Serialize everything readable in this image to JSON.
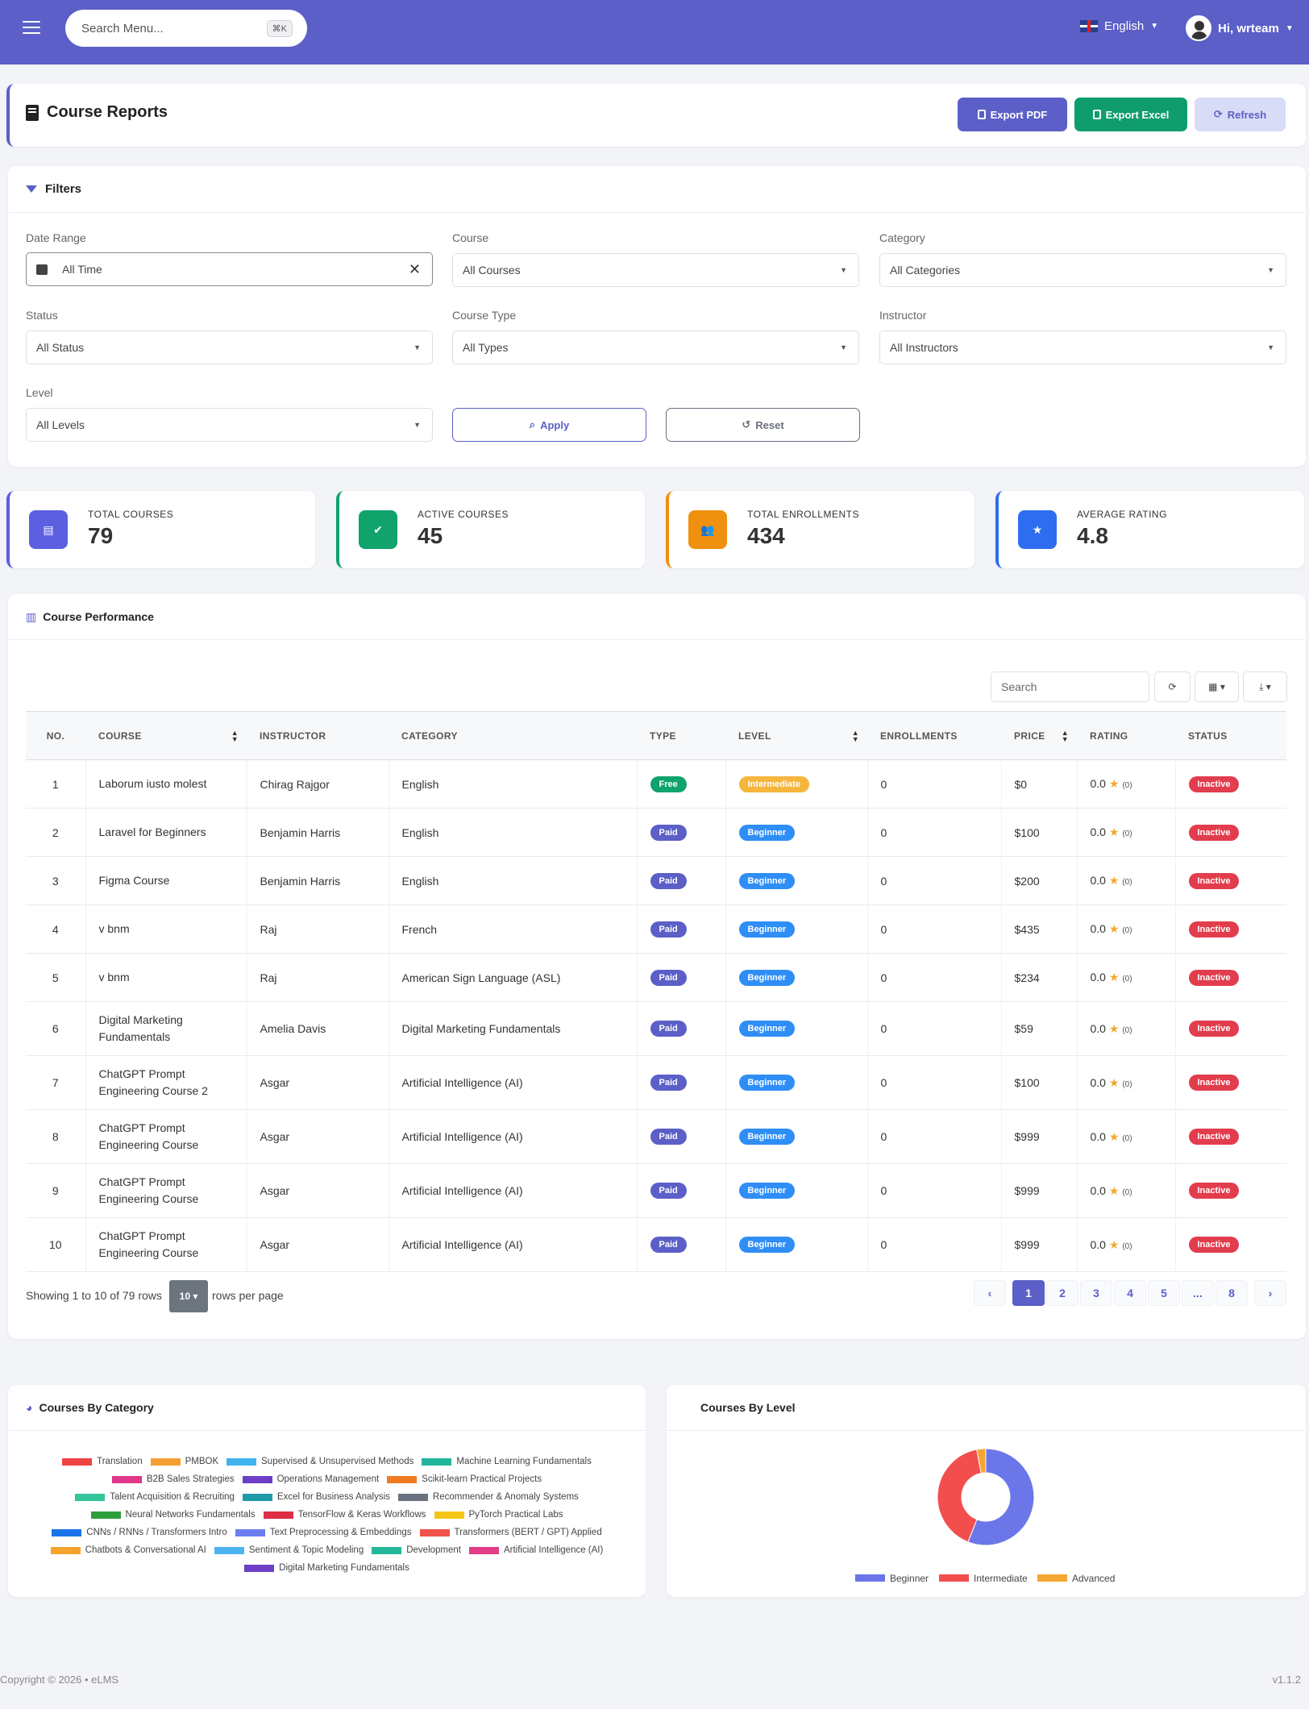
{
  "topbar": {
    "search_placeholder": "Search Menu...",
    "search_shortcut": "⌘K",
    "language": "English",
    "greeting": "Hi, wrteam"
  },
  "header": {
    "title": "Course Reports",
    "export_pdf": "Export PDF",
    "export_excel": "Export Excel",
    "refresh": "Refresh"
  },
  "filters": {
    "title": "Filters",
    "date_range": {
      "label": "Date Range",
      "value": "All Time"
    },
    "course": {
      "label": "Course",
      "value": "All Courses"
    },
    "category": {
      "label": "Category",
      "value": "All Categories"
    },
    "status": {
      "label": "Status",
      "value": "All Status"
    },
    "course_type": {
      "label": "Course Type",
      "value": "All Types"
    },
    "instructor": {
      "label": "Instructor",
      "value": "All Instructors"
    },
    "level": {
      "label": "Level",
      "value": "All Levels"
    },
    "apply": "Apply",
    "reset": "Reset"
  },
  "stats": [
    {
      "label": "TOTAL COURSES",
      "value": "79",
      "color": "#5b5fe0"
    },
    {
      "label": "ACTIVE COURSES",
      "value": "45",
      "color": "#10a36c"
    },
    {
      "label": "TOTAL ENROLLMENTS",
      "value": "434",
      "color": "#f0900f"
    },
    {
      "label": "AVERAGE RATING",
      "value": "4.8",
      "color": "#2f6df0"
    }
  ],
  "performance": {
    "title": "Course Performance",
    "search_placeholder": "Search",
    "columns": [
      "NO.",
      "COURSE",
      "INSTRUCTOR",
      "CATEGORY",
      "TYPE",
      "LEVEL",
      "ENROLLMENTS",
      "PRICE",
      "RATING",
      "STATUS"
    ],
    "rows": [
      {
        "no": "1",
        "course": "Laborum iusto molest",
        "instructor": "Chirag Rajgor",
        "category": "English",
        "type": "Free",
        "level": "Intermediate",
        "enrollments": "0",
        "price": "$0",
        "rating": "0.0",
        "rating_count": "(0)",
        "status": "Inactive"
      },
      {
        "no": "2",
        "course": "Laravel for Beginners",
        "instructor": "Benjamin Harris",
        "category": "English",
        "type": "Paid",
        "level": "Beginner",
        "enrollments": "0",
        "price": "$100",
        "rating": "0.0",
        "rating_count": "(0)",
        "status": "Inactive"
      },
      {
        "no": "3",
        "course": "Figma Course",
        "instructor": "Benjamin Harris",
        "category": "English",
        "type": "Paid",
        "level": "Beginner",
        "enrollments": "0",
        "price": "$200",
        "rating": "0.0",
        "rating_count": "(0)",
        "status": "Inactive"
      },
      {
        "no": "4",
        "course": "v bnm",
        "instructor": "Raj",
        "category": "French",
        "type": "Paid",
        "level": "Beginner",
        "enrollments": "0",
        "price": "$435",
        "rating": "0.0",
        "rating_count": "(0)",
        "status": "Inactive"
      },
      {
        "no": "5",
        "course": "v bnm",
        "instructor": "Raj",
        "category": "American Sign Language (ASL)",
        "type": "Paid",
        "level": "Beginner",
        "enrollments": "0",
        "price": "$234",
        "rating": "0.0",
        "rating_count": "(0)",
        "status": "Inactive"
      },
      {
        "no": "6",
        "course": "Digital Marketing Fundamentals",
        "instructor": "Amelia Davis",
        "category": "Digital Marketing Fundamentals",
        "type": "Paid",
        "level": "Beginner",
        "enrollments": "0",
        "price": "$59",
        "rating": "0.0",
        "rating_count": "(0)",
        "status": "Inactive"
      },
      {
        "no": "7",
        "course": "ChatGPT Prompt Engineering Course 2",
        "instructor": "Asgar",
        "category": "Artificial Intelligence (AI)",
        "type": "Paid",
        "level": "Beginner",
        "enrollments": "0",
        "price": "$100",
        "rating": "0.0",
        "rating_count": "(0)",
        "status": "Inactive"
      },
      {
        "no": "8",
        "course": "ChatGPT Prompt Engineering Course",
        "instructor": "Asgar",
        "category": "Artificial Intelligence (AI)",
        "type": "Paid",
        "level": "Beginner",
        "enrollments": "0",
        "price": "$999",
        "rating": "0.0",
        "rating_count": "(0)",
        "status": "Inactive"
      },
      {
        "no": "9",
        "course": "ChatGPT Prompt Engineering Course",
        "instructor": "Asgar",
        "category": "Artificial Intelligence (AI)",
        "type": "Paid",
        "level": "Beginner",
        "enrollments": "0",
        "price": "$999",
        "rating": "0.0",
        "rating_count": "(0)",
        "status": "Inactive"
      },
      {
        "no": "10",
        "course": "ChatGPT Prompt Engineering Course",
        "instructor": "Asgar",
        "category": "Artificial Intelligence (AI)",
        "type": "Paid",
        "level": "Beginner",
        "enrollments": "0",
        "price": "$999",
        "rating": "0.0",
        "rating_count": "(0)",
        "status": "Inactive"
      }
    ],
    "showing": "Showing 1 to 10 of 79 rows",
    "per_page_value": "10 ▾",
    "per_page_label": "rows per page",
    "pages": [
      "‹",
      "1",
      "2",
      "3",
      "4",
      "5",
      "...",
      "8",
      "›"
    ],
    "active_page": "1"
  },
  "category_chart": {
    "title": "Courses By Category",
    "legend": [
      {
        "name": "Translation",
        "color": "#ef4444"
      },
      {
        "name": "PMBOK",
        "color": "#f59e33"
      },
      {
        "name": "Supervised & Unsupervised Methods",
        "color": "#3fb3ee"
      },
      {
        "name": "Machine Learning Fundamentals",
        "color": "#23b59b"
      },
      {
        "name": "B2B Sales Strategies",
        "color": "#e0378a"
      },
      {
        "name": "Operations Management",
        "color": "#6d3fc4"
      },
      {
        "name": "Scikit-learn Practical Projects",
        "color": "#f07b22"
      },
      {
        "name": "Talent Acquisition & Recruiting",
        "color": "#33c49a"
      },
      {
        "name": "Excel for Business Analysis",
        "color": "#1f9aa8"
      },
      {
        "name": "Recommender & Anomaly Systems",
        "color": "#6b7280"
      },
      {
        "name": "Neural Networks Fundamentals",
        "color": "#2e9e3d"
      },
      {
        "name": "TensorFlow & Keras Workflows",
        "color": "#dc2f45"
      },
      {
        "name": "PyTorch Practical Labs",
        "color": "#f5c518"
      },
      {
        "name": "CNNs / RNNs / Transformers Intro",
        "color": "#1a73e8"
      },
      {
        "name": "Text Preprocessing & Embeddings",
        "color": "#6b7ef0"
      },
      {
        "name": "Transformers (BERT / GPT) Applied",
        "color": "#f0534a"
      },
      {
        "name": "Chatbots & Conversational AI",
        "color": "#f5a32a"
      },
      {
        "name": "Sentiment & Topic Modeling",
        "color": "#4cb4f0"
      },
      {
        "name": "Development",
        "color": "#25b79a"
      },
      {
        "name": "Artificial Intelligence (AI)",
        "color": "#e23d86"
      },
      {
        "name": "Digital Marketing Fundamentals",
        "color": "#6d3fc4"
      }
    ]
  },
  "level_chart": {
    "title": "Courses By Level",
    "chart_data": {
      "type": "pie",
      "categories": [
        "Beginner",
        "Intermediate",
        "Advanced"
      ],
      "values": [
        56,
        41,
        3
      ],
      "colors": [
        "#6b77e8",
        "#f24e4e",
        "#f5a632"
      ]
    }
  },
  "footer": {
    "copyright": "Copyright © 2026 • eLMS",
    "version": "v1.1.2"
  }
}
